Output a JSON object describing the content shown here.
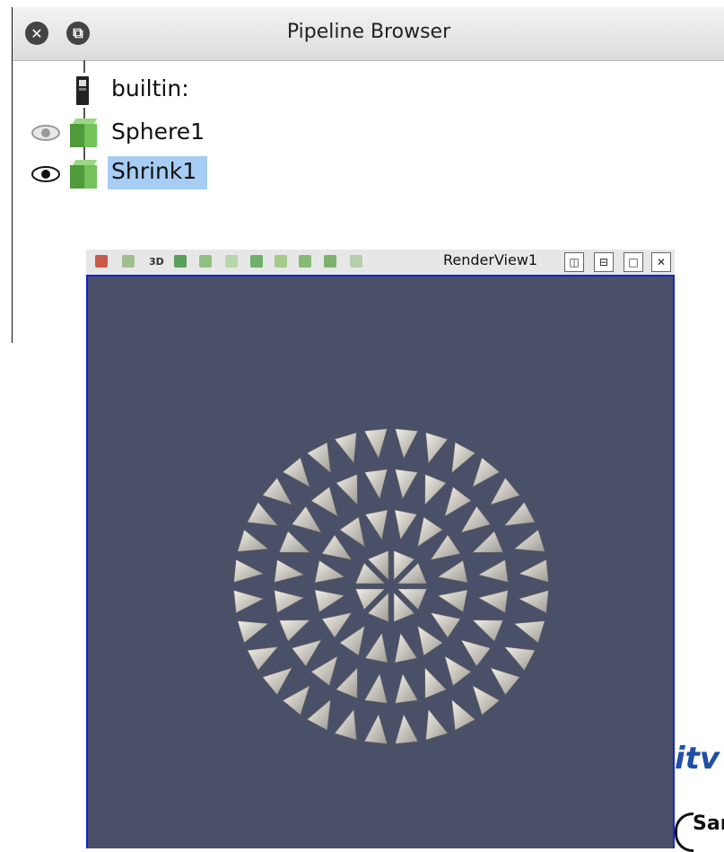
{
  "pipeline_browser": {
    "title": "Pipeline Browser",
    "items": [
      {
        "label": "builtin:",
        "icon": "server-icon",
        "visible": null
      },
      {
        "label": "Sphere1",
        "icon": "green-cube-icon",
        "visible": false
      },
      {
        "label": "Shrink1",
        "icon": "green-cube-icon",
        "visible": true,
        "selected": true
      }
    ]
  },
  "render_view": {
    "title": "RenderView1",
    "toolbar_3d_label": "3D",
    "background_color": "#4a5068",
    "border_color": "#1024d8"
  },
  "background_logo": {
    "text": "itv",
    "subtext": "Sar"
  }
}
